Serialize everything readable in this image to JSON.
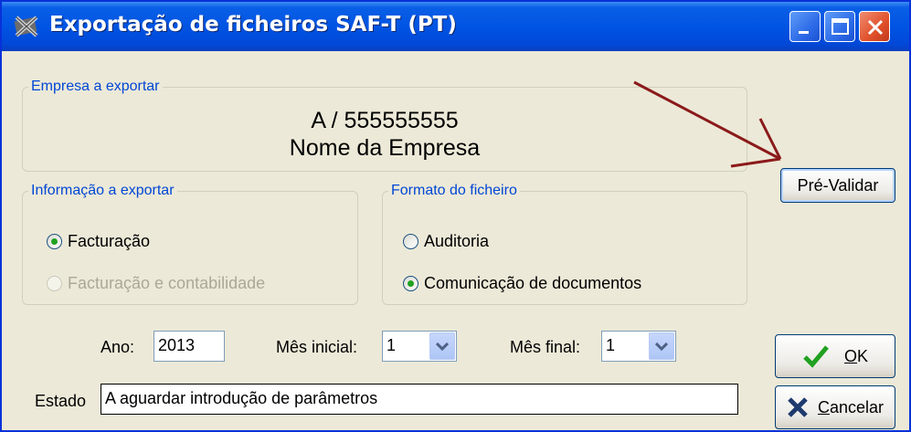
{
  "window": {
    "title": "Exportação de ficheiros SAF-T (PT)",
    "icons": [
      "app-icon",
      "minimize-icon",
      "maximize-icon",
      "close-icon"
    ]
  },
  "company_group": {
    "legend": "Empresa a exportar",
    "line1": "A / 555555555",
    "line2": "Nome da Empresa"
  },
  "info_group": {
    "legend": "Informação a exportar",
    "options": [
      {
        "label": "Facturação",
        "checked": true,
        "disabled": false
      },
      {
        "label": "Facturação e contabilidade",
        "checked": false,
        "disabled": true
      }
    ]
  },
  "format_group": {
    "legend": "Formato do ficheiro",
    "options": [
      {
        "label": "Auditoria",
        "checked": false
      },
      {
        "label": "Comunicação de documentos",
        "checked": true
      }
    ]
  },
  "buttons": {
    "prevalidate": "Pré-Validar",
    "ok_prefix": "",
    "ok_mnemonic": "O",
    "ok_rest": "K",
    "cancel_mnemonic": "C",
    "cancel_rest": "ancelar"
  },
  "fields": {
    "year_label": "Ano:",
    "year_value": "2013",
    "month_start_label": "Mês inicial:",
    "month_start_value": "1",
    "month_end_label": "Mês final:",
    "month_end_value": "1",
    "status_label": "Estado",
    "status_value": "A aguardar introdução de parâmetros"
  },
  "colors": {
    "titlebar": "#0054e3",
    "legend_text": "#0046d5",
    "arrow": "#8b1a1a",
    "check": "#21a121",
    "cancel_x": "#1e3a6e"
  }
}
